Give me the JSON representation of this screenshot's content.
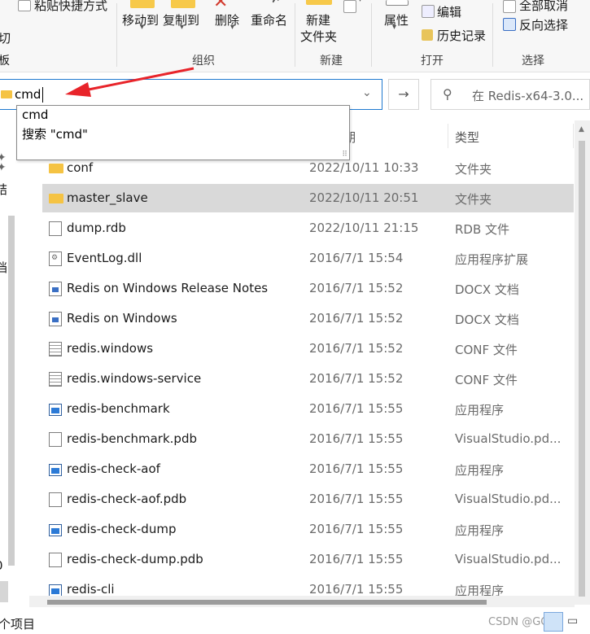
{
  "ribbon": {
    "paste_shortcut": "粘贴快捷方式",
    "cut_fragment": "切",
    "board_fragment": "板",
    "move_to": "移动到",
    "copy_to": "复制到",
    "delete": "删除",
    "rename": "重命名",
    "new_folder_line1": "新建",
    "new_folder_line2": "文件夹",
    "properties": "属性",
    "edit": "编辑",
    "history": "历史记录",
    "select_none": "全部取消",
    "invert_selection": "反向选择",
    "group_organize": "组织",
    "group_new": "新建",
    "group_open": "打开",
    "group_select": "选择"
  },
  "address": {
    "value": "cmd",
    "chevron": "⌄",
    "go_arrow": "→"
  },
  "search": {
    "placeholder": "在 Redis-x64-3.0..."
  },
  "autocomplete": {
    "item1": "cmd",
    "item2": "搜索 \"cmd\""
  },
  "list": {
    "header_date_fragment": "期",
    "header_type": "类型",
    "rows": [
      {
        "name": "conf",
        "date": "2022/10/11 10:33",
        "type": "文件夹",
        "icon": "folder"
      },
      {
        "name": "master_slave",
        "date": "2022/10/11 20:51",
        "type": "文件夹",
        "icon": "folder"
      },
      {
        "name": "dump.rdb",
        "date": "2022/10/11 21:15",
        "type": "RDB 文件",
        "icon": "file"
      },
      {
        "name": "EventLog.dll",
        "date": "2016/7/1 15:54",
        "type": "应用程序扩展",
        "icon": "dll"
      },
      {
        "name": "Redis on Windows Release Notes",
        "date": "2016/7/1 15:52",
        "type": "DOCX 文档",
        "icon": "docx"
      },
      {
        "name": "Redis on Windows",
        "date": "2016/7/1 15:52",
        "type": "DOCX 文档",
        "icon": "docx"
      },
      {
        "name": "redis.windows",
        "date": "2016/7/1 15:52",
        "type": "CONF 文件",
        "icon": "text"
      },
      {
        "name": "redis.windows-service",
        "date": "2016/7/1 15:52",
        "type": "CONF 文件",
        "icon": "text"
      },
      {
        "name": "redis-benchmark",
        "date": "2016/7/1 15:55",
        "type": "应用程序",
        "icon": "exe"
      },
      {
        "name": "redis-benchmark.pdb",
        "date": "2016/7/1 15:55",
        "type": "VisualStudio.pd...",
        "icon": "file"
      },
      {
        "name": "redis-check-aof",
        "date": "2016/7/1 15:55",
        "type": "应用程序",
        "icon": "exe"
      },
      {
        "name": "redis-check-aof.pdb",
        "date": "2016/7/1 15:55",
        "type": "VisualStudio.pd...",
        "icon": "file"
      },
      {
        "name": "redis-check-dump",
        "date": "2016/7/1 15:55",
        "type": "应用程序",
        "icon": "exe"
      },
      {
        "name": "redis-check-dump.pdb",
        "date": "2016/7/1 15:55",
        "type": "VisualStudio.pd...",
        "icon": "file"
      },
      {
        "name": "redis-cli",
        "date": "2016/7/1 15:55",
        "type": "应用程序",
        "icon": "exe"
      }
    ]
  },
  "nav": {
    "fragment1": "结",
    "fragment2": "档",
    "fragment3": "0"
  },
  "status": {
    "items_fragment": "个项目",
    "watermark": "CSDN @GCT"
  }
}
